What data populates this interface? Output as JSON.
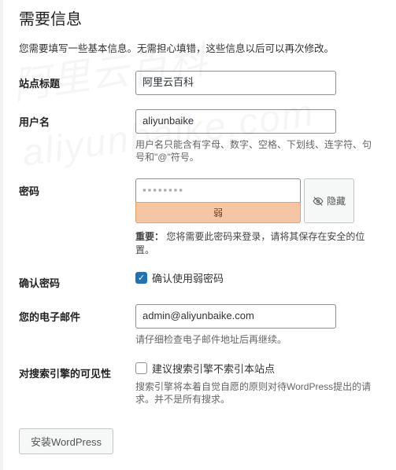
{
  "heading": "需要信息",
  "intro": "您需要填写一些基本信息。无需担心填错，这些信息以后可以再次修改。",
  "fields": {
    "site_title": {
      "label": "站点标题",
      "value": "阿里云百科"
    },
    "username": {
      "label": "用户名",
      "value": "aliyunbaike",
      "hint": "用户名只能含有字母、数字、空格、下划线、连字符、句号和\"@\"符号。"
    },
    "password": {
      "label": "密码",
      "masked": "▪▪▪▪▪▪▪▪",
      "hide_btn": "隐藏",
      "strength": "弱",
      "note_prefix": "重要：",
      "note": "您将需要此密码来登录，请将其保存在安全的位置。"
    },
    "confirm": {
      "label": "确认密码",
      "checkbox_label": "确认使用弱密码"
    },
    "email": {
      "label": "您的电子邮件",
      "value": "admin@aliyunbaike.com",
      "hint": "请仔细检查电子邮件地址后再继续。"
    },
    "visibility": {
      "label": "对搜索引擎的可见性",
      "checkbox_label": "建议搜索引擎不索引本站点",
      "hint": "搜索引擎将本着自觉自愿的原则对待WordPress提出的请求。并不是所有搜求。"
    }
  },
  "submit": "安装WordPress",
  "watermark": "阿里云百科 aliyunbaike.com"
}
